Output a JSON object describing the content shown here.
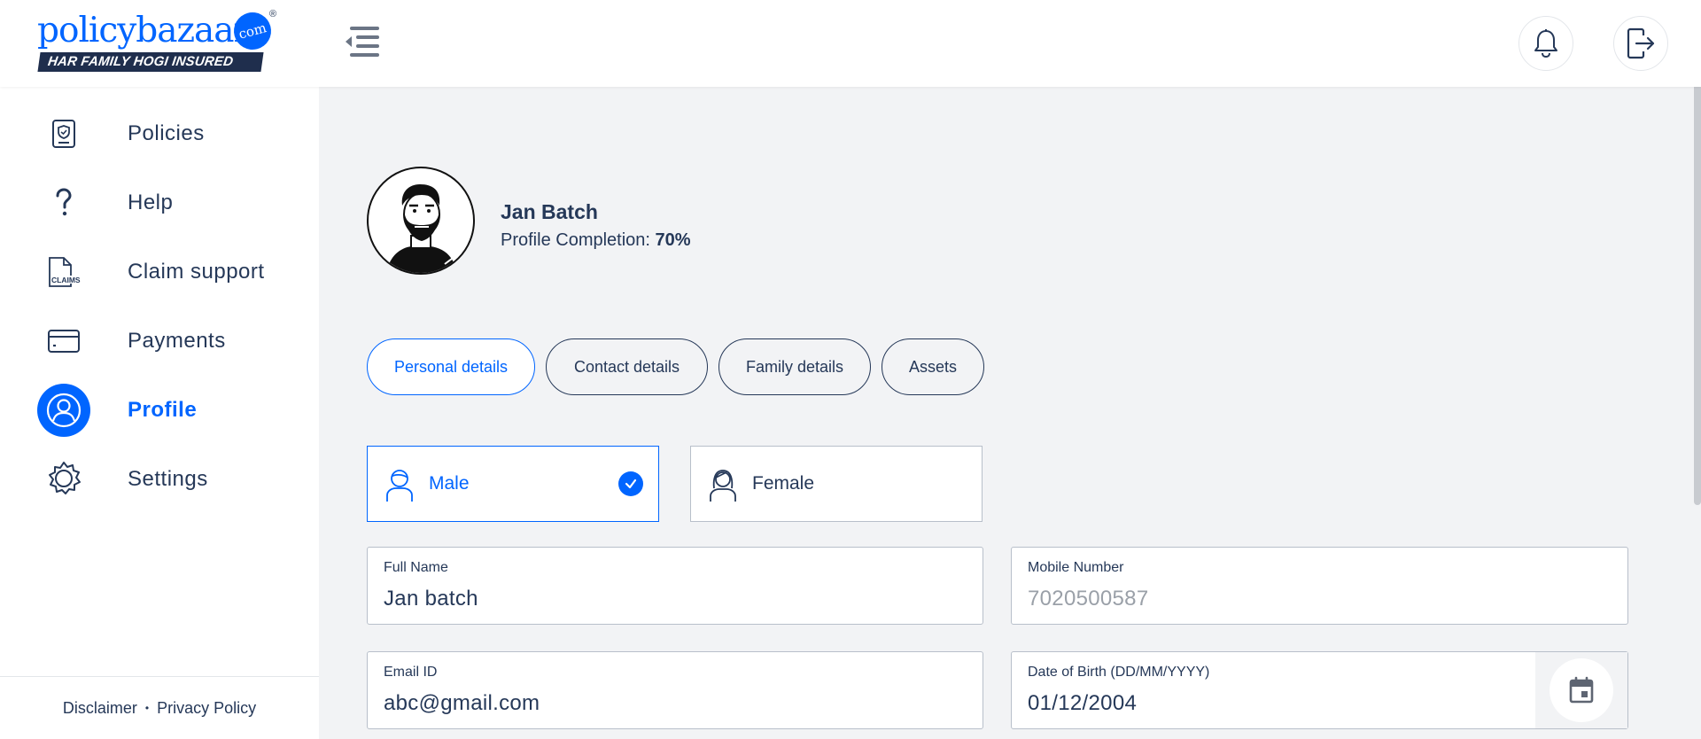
{
  "brand": {
    "name": "policybazaar",
    "domain_badge": "com",
    "registered_mark": "®",
    "tagline": "HAR FAMILY HOGI INSURED"
  },
  "header": {
    "menu_icon": "menu-collapse-icon",
    "notification_icon": "bell-icon",
    "logout_icon": "logout-icon"
  },
  "sidebar": {
    "items": [
      {
        "label": "Policies",
        "icon": "policy-document-icon",
        "active": false
      },
      {
        "label": "Help",
        "icon": "question-mark-icon",
        "active": false
      },
      {
        "label": "Claim support",
        "icon": "claims-document-icon",
        "active": false
      },
      {
        "label": "Payments",
        "icon": "credit-card-icon",
        "active": false
      },
      {
        "label": "Profile",
        "icon": "user-icon",
        "active": true
      },
      {
        "label": "Settings",
        "icon": "gear-icon",
        "active": false
      }
    ],
    "footer": {
      "disclaimer": "Disclaimer",
      "separator": "•",
      "privacy": "Privacy Policy"
    }
  },
  "profile": {
    "name": "Jan Batch",
    "completion_label": "Profile Completion:",
    "completion_value": "70%"
  },
  "tabs": [
    {
      "label": "Personal details",
      "active": true
    },
    {
      "label": "Contact details",
      "active": false
    },
    {
      "label": "Family details",
      "active": false
    },
    {
      "label": "Assets",
      "active": false
    }
  ],
  "gender": {
    "options": [
      {
        "label": "Male",
        "selected": true
      },
      {
        "label": "Female",
        "selected": false
      }
    ]
  },
  "form": {
    "full_name": {
      "label": "Full Name",
      "value": "Jan batch"
    },
    "mobile": {
      "label": "Mobile Number",
      "value": "7020500587"
    },
    "email": {
      "label": "Email ID",
      "value": "abc@gmail.com"
    },
    "dob": {
      "label": "Date of Birth (DD/MM/YYYY)",
      "value": "01/12/2004",
      "icon": "calendar-icon"
    }
  },
  "colors": {
    "accent": "#0065ff",
    "text": "#253858",
    "background": "#f2f3f5"
  }
}
